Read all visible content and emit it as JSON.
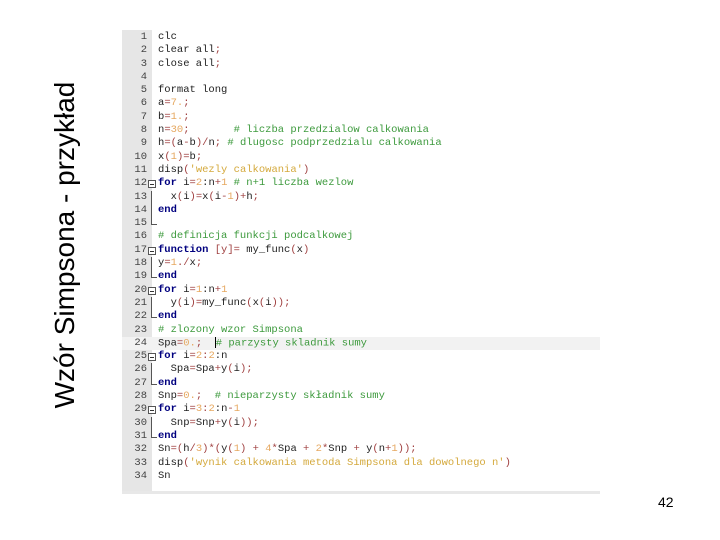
{
  "slide": {
    "title": "Wzór Simpsona - przykład",
    "page_number": "42"
  },
  "editor": {
    "active_line": 24,
    "fold_start_lines": [
      12,
      17,
      20,
      25,
      29
    ],
    "fold_body_lines": [
      13,
      14,
      18,
      21,
      26,
      30
    ],
    "fold_end_lines": [
      15,
      19,
      22,
      27,
      31
    ],
    "lines": [
      [
        [
          "clc",
          "t"
        ]
      ],
      [
        [
          "clear all",
          "t"
        ],
        [
          ";",
          "o"
        ]
      ],
      [
        [
          "close all",
          "t"
        ],
        [
          ";",
          "o"
        ]
      ],
      [],
      [
        [
          "format long",
          "t"
        ]
      ],
      [
        [
          "a",
          "t"
        ],
        [
          "=",
          "o"
        ],
        [
          "7.",
          "n"
        ],
        [
          ";",
          "o"
        ]
      ],
      [
        [
          "b",
          "t"
        ],
        [
          "=",
          "o"
        ],
        [
          "1.",
          "n"
        ],
        [
          ";",
          "o"
        ]
      ],
      [
        [
          "n",
          "t"
        ],
        [
          "=",
          "o"
        ],
        [
          "30",
          "n"
        ],
        [
          ";",
          "o"
        ],
        [
          "       # liczba przedzialow calkowania",
          "c"
        ]
      ],
      [
        [
          "h",
          "t"
        ],
        [
          "=(",
          "o"
        ],
        [
          "a",
          "t"
        ],
        [
          "-",
          "o"
        ],
        [
          "b",
          "t"
        ],
        [
          ")/",
          "o"
        ],
        [
          "n",
          "t"
        ],
        [
          ";",
          "o"
        ],
        [
          " # dlugosc podprzedzialu calkowania",
          "c"
        ]
      ],
      [
        [
          "x",
          "t"
        ],
        [
          "(",
          "o"
        ],
        [
          "1",
          "n"
        ],
        [
          ")=",
          "o"
        ],
        [
          "b",
          "t"
        ],
        [
          ";",
          "o"
        ]
      ],
      [
        [
          "disp",
          "t"
        ],
        [
          "(",
          "o"
        ],
        [
          "'wezly calkowania'",
          "s"
        ],
        [
          ")",
          "o"
        ]
      ],
      [
        [
          "for",
          "k"
        ],
        [
          " i",
          "t"
        ],
        [
          "=",
          "o"
        ],
        [
          "2",
          "n"
        ],
        [
          ":n",
          "t"
        ],
        [
          "+",
          "o"
        ],
        [
          "1",
          "n"
        ],
        [
          " # n+1 liczba wezlow",
          "c"
        ]
      ],
      [
        [
          "  x",
          "t"
        ],
        [
          "(",
          "o"
        ],
        [
          "i",
          "t"
        ],
        [
          ")=",
          "o"
        ],
        [
          "x",
          "t"
        ],
        [
          "(",
          "o"
        ],
        [
          "i",
          "t"
        ],
        [
          "-",
          "o"
        ],
        [
          "1",
          "n"
        ],
        [
          ")+",
          "o"
        ],
        [
          "h",
          "t"
        ],
        [
          ";",
          "o"
        ]
      ],
      [
        [
          "end",
          "k"
        ]
      ],
      [],
      [
        [
          "# definicja funkcji podcalkowej",
          "c"
        ]
      ],
      [
        [
          "function",
          "k"
        ],
        [
          " [y]= ",
          "o"
        ],
        [
          "my_func",
          "t"
        ],
        [
          "(",
          "o"
        ],
        [
          "x",
          "t"
        ],
        [
          ")",
          "o"
        ]
      ],
      [
        [
          "y",
          "t"
        ],
        [
          "=",
          "o"
        ],
        [
          "1",
          "n"
        ],
        [
          "./",
          "o"
        ],
        [
          "x",
          "t"
        ],
        [
          ";",
          "o"
        ]
      ],
      [
        [
          "end",
          "k"
        ]
      ],
      [
        [
          "for",
          "k"
        ],
        [
          " i",
          "t"
        ],
        [
          "=",
          "o"
        ],
        [
          "1",
          "n"
        ],
        [
          ":n",
          "t"
        ],
        [
          "+",
          "o"
        ],
        [
          "1",
          "n"
        ]
      ],
      [
        [
          "  y",
          "t"
        ],
        [
          "(",
          "o"
        ],
        [
          "i",
          "t"
        ],
        [
          ")=",
          "o"
        ],
        [
          "my_func",
          "t"
        ],
        [
          "(",
          "o"
        ],
        [
          "x",
          "t"
        ],
        [
          "(",
          "o"
        ],
        [
          "i",
          "t"
        ],
        [
          "));",
          "o"
        ]
      ],
      [
        [
          "end",
          "k"
        ]
      ],
      [
        [
          "# zlozony wzor Simpsona",
          "c"
        ]
      ],
      [
        [
          "Spa",
          "t"
        ],
        [
          "=",
          "o"
        ],
        [
          "0.",
          "n"
        ],
        [
          ";",
          "o"
        ],
        [
          "  ",
          "t"
        ],
        [
          "# parzysty skladnik sumy",
          "c"
        ]
      ],
      [
        [
          "for",
          "k"
        ],
        [
          " i",
          "t"
        ],
        [
          "=",
          "o"
        ],
        [
          "2",
          "n"
        ],
        [
          ":",
          "o"
        ],
        [
          "2",
          "n"
        ],
        [
          ":n",
          "t"
        ]
      ],
      [
        [
          "  Spa",
          "t"
        ],
        [
          "=",
          "o"
        ],
        [
          "Spa",
          "t"
        ],
        [
          "+",
          "o"
        ],
        [
          "y",
          "t"
        ],
        [
          "(",
          "o"
        ],
        [
          "i",
          "t"
        ],
        [
          ");",
          "o"
        ]
      ],
      [
        [
          "end",
          "k"
        ]
      ],
      [
        [
          "Snp",
          "t"
        ],
        [
          "=",
          "o"
        ],
        [
          "0.",
          "n"
        ],
        [
          ";",
          "o"
        ],
        [
          "  # nieparzysty składnik sumy",
          "c"
        ]
      ],
      [
        [
          "for",
          "k"
        ],
        [
          " i",
          "t"
        ],
        [
          "=",
          "o"
        ],
        [
          "3",
          "n"
        ],
        [
          ":",
          "o"
        ],
        [
          "2",
          "n"
        ],
        [
          ":n",
          "t"
        ],
        [
          "-",
          "o"
        ],
        [
          "1",
          "n"
        ]
      ],
      [
        [
          "  Snp",
          "t"
        ],
        [
          "=",
          "o"
        ],
        [
          "Snp",
          "t"
        ],
        [
          "+",
          "o"
        ],
        [
          "y",
          "t"
        ],
        [
          "(",
          "o"
        ],
        [
          "i",
          "t"
        ],
        [
          "));",
          "o"
        ]
      ],
      [
        [
          "end",
          "k"
        ]
      ],
      [
        [
          "Sn",
          "t"
        ],
        [
          "=(",
          "o"
        ],
        [
          "h",
          "t"
        ],
        [
          "/",
          "o"
        ],
        [
          "3",
          "n"
        ],
        [
          ")*(",
          "o"
        ],
        [
          "y",
          "t"
        ],
        [
          "(",
          "o"
        ],
        [
          "1",
          "n"
        ],
        [
          ")",
          "o"
        ],
        [
          " + ",
          "o"
        ],
        [
          "4",
          "n"
        ],
        [
          "*",
          "o"
        ],
        [
          "Spa",
          "t"
        ],
        [
          " + ",
          "o"
        ],
        [
          "2",
          "n"
        ],
        [
          "*",
          "o"
        ],
        [
          "Snp",
          "t"
        ],
        [
          " + ",
          "o"
        ],
        [
          "y",
          "t"
        ],
        [
          "(",
          "o"
        ],
        [
          "n",
          "t"
        ],
        [
          "+",
          "o"
        ],
        [
          "1",
          "n"
        ],
        [
          "));",
          "o"
        ]
      ],
      [
        [
          "disp",
          "t"
        ],
        [
          "(",
          "o"
        ],
        [
          "'wynik calkowania metoda Simpsona dla dowolnego n'",
          "s"
        ],
        [
          ")",
          "o"
        ]
      ],
      [
        [
          "Sn",
          "t"
        ]
      ]
    ]
  }
}
